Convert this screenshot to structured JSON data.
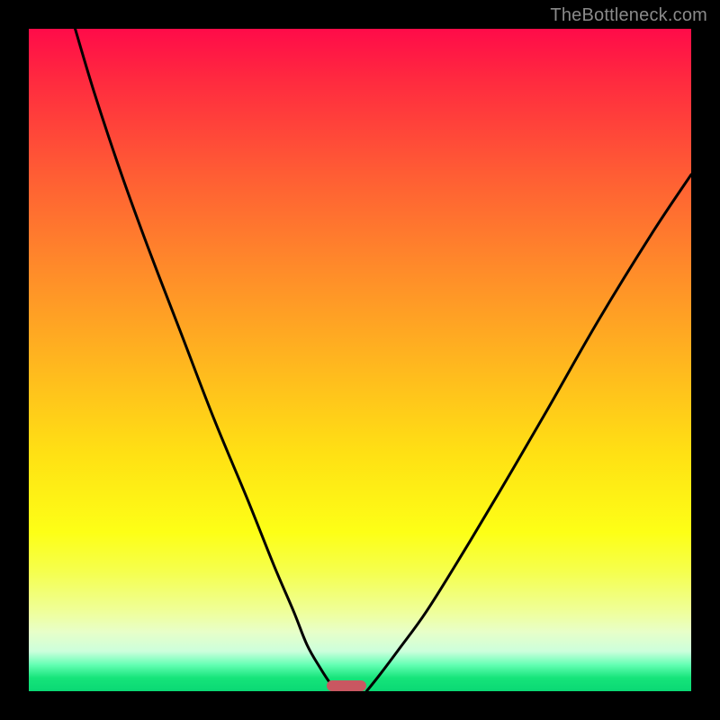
{
  "watermark": "TheBottleneck.com",
  "chart_data": {
    "type": "line",
    "title": "",
    "xlabel": "",
    "ylabel": "",
    "xlim": [
      0,
      100
    ],
    "ylim": [
      0,
      100
    ],
    "grid": false,
    "background_gradient": {
      "direction": "top-to-bottom",
      "stops": [
        {
          "pos": 0,
          "color": "#ff0b49"
        },
        {
          "pos": 8,
          "color": "#ff2b3f"
        },
        {
          "pos": 22,
          "color": "#ff5d34"
        },
        {
          "pos": 36,
          "color": "#ff8a2a"
        },
        {
          "pos": 50,
          "color": "#ffb51f"
        },
        {
          "pos": 64,
          "color": "#ffe014"
        },
        {
          "pos": 76,
          "color": "#fdff16"
        },
        {
          "pos": 82,
          "color": "#f5ff4e"
        },
        {
          "pos": 88,
          "color": "#efff9a"
        },
        {
          "pos": 91,
          "color": "#e8ffc8"
        },
        {
          "pos": 94,
          "color": "#ccffdc"
        },
        {
          "pos": 96,
          "color": "#64ffb4"
        },
        {
          "pos": 98,
          "color": "#16e47a"
        },
        {
          "pos": 100,
          "color": "#0ad874"
        }
      ]
    },
    "series": [
      {
        "name": "curve-left",
        "x": [
          7,
          10,
          14,
          18,
          23,
          28,
          33,
          37,
          40,
          42,
          44,
          45.5,
          46.5
        ],
        "y": [
          100,
          90,
          78,
          67,
          54,
          41,
          29,
          19,
          12,
          7,
          3.5,
          1.2,
          0
        ]
      },
      {
        "name": "curve-right",
        "x": [
          51,
          53,
          56,
          60,
          65,
          71,
          78,
          86,
          94,
          100
        ],
        "y": [
          0,
          2.5,
          6.5,
          12,
          20,
          30,
          42,
          56,
          69,
          78
        ]
      }
    ],
    "marker": {
      "name": "zero-bottleneck-range",
      "x_from": 45,
      "x_to": 51,
      "y": 0,
      "color": "#c95761"
    }
  }
}
